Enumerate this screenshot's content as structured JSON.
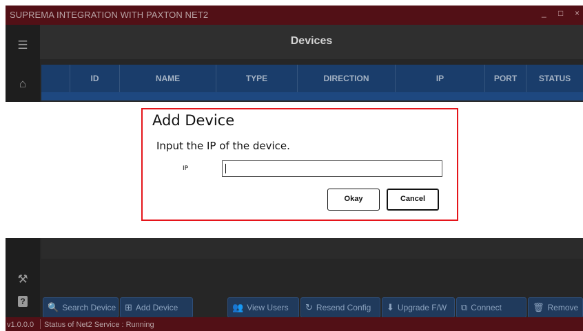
{
  "window": {
    "title": "SUPREMA INTEGRATION WITH PAXTON NET2",
    "minimize_glyph": "_",
    "maximize_glyph": "□",
    "close_glyph": "×"
  },
  "sidebar": {
    "items": [
      {
        "icon": "menu-icon",
        "glyph": "☰"
      },
      {
        "icon": "home-icon",
        "glyph": "⌂"
      },
      {
        "icon": "tools-icon",
        "glyph": "⚒"
      },
      {
        "icon": "help-icon",
        "glyph": "?"
      }
    ]
  },
  "page": {
    "title": "Devices"
  },
  "table": {
    "columns": [
      "ID",
      "NAME",
      "TYPE",
      "DIRECTION",
      "IP",
      "PORT",
      "STATUS"
    ]
  },
  "toolbar": {
    "buttons": [
      {
        "label": "Search Device",
        "icon": "search-icon",
        "glyph": "🔍"
      },
      {
        "label": "Add Device",
        "icon": "add-device-icon",
        "glyph": "⊞"
      },
      {
        "label": "View Users",
        "icon": "users-icon",
        "glyph": "👥"
      },
      {
        "label": "Resend Config",
        "icon": "refresh-icon",
        "glyph": "↻"
      },
      {
        "label": "Upgrade F/W",
        "icon": "download-icon",
        "glyph": "⬇"
      },
      {
        "label": "Connect",
        "icon": "connect-icon",
        "glyph": "⧉"
      },
      {
        "label": "Remove",
        "icon": "trash-icon",
        "glyph": "🗑"
      }
    ]
  },
  "status_bar": {
    "version": "v1.0.0.0",
    "service_status": "Status of Net2 Service : Running"
  },
  "dialog": {
    "title": "Add Device",
    "message": "Input the IP of the device.",
    "ip_label": "IP",
    "ip_value": "",
    "okay_label": "Okay",
    "cancel_label": "Cancel"
  },
  "colors": {
    "titlebar": "#521016",
    "table_header": "#1a3d6b",
    "dialog_border": "#e5141a",
    "toolbar_button": "#203a5c"
  }
}
